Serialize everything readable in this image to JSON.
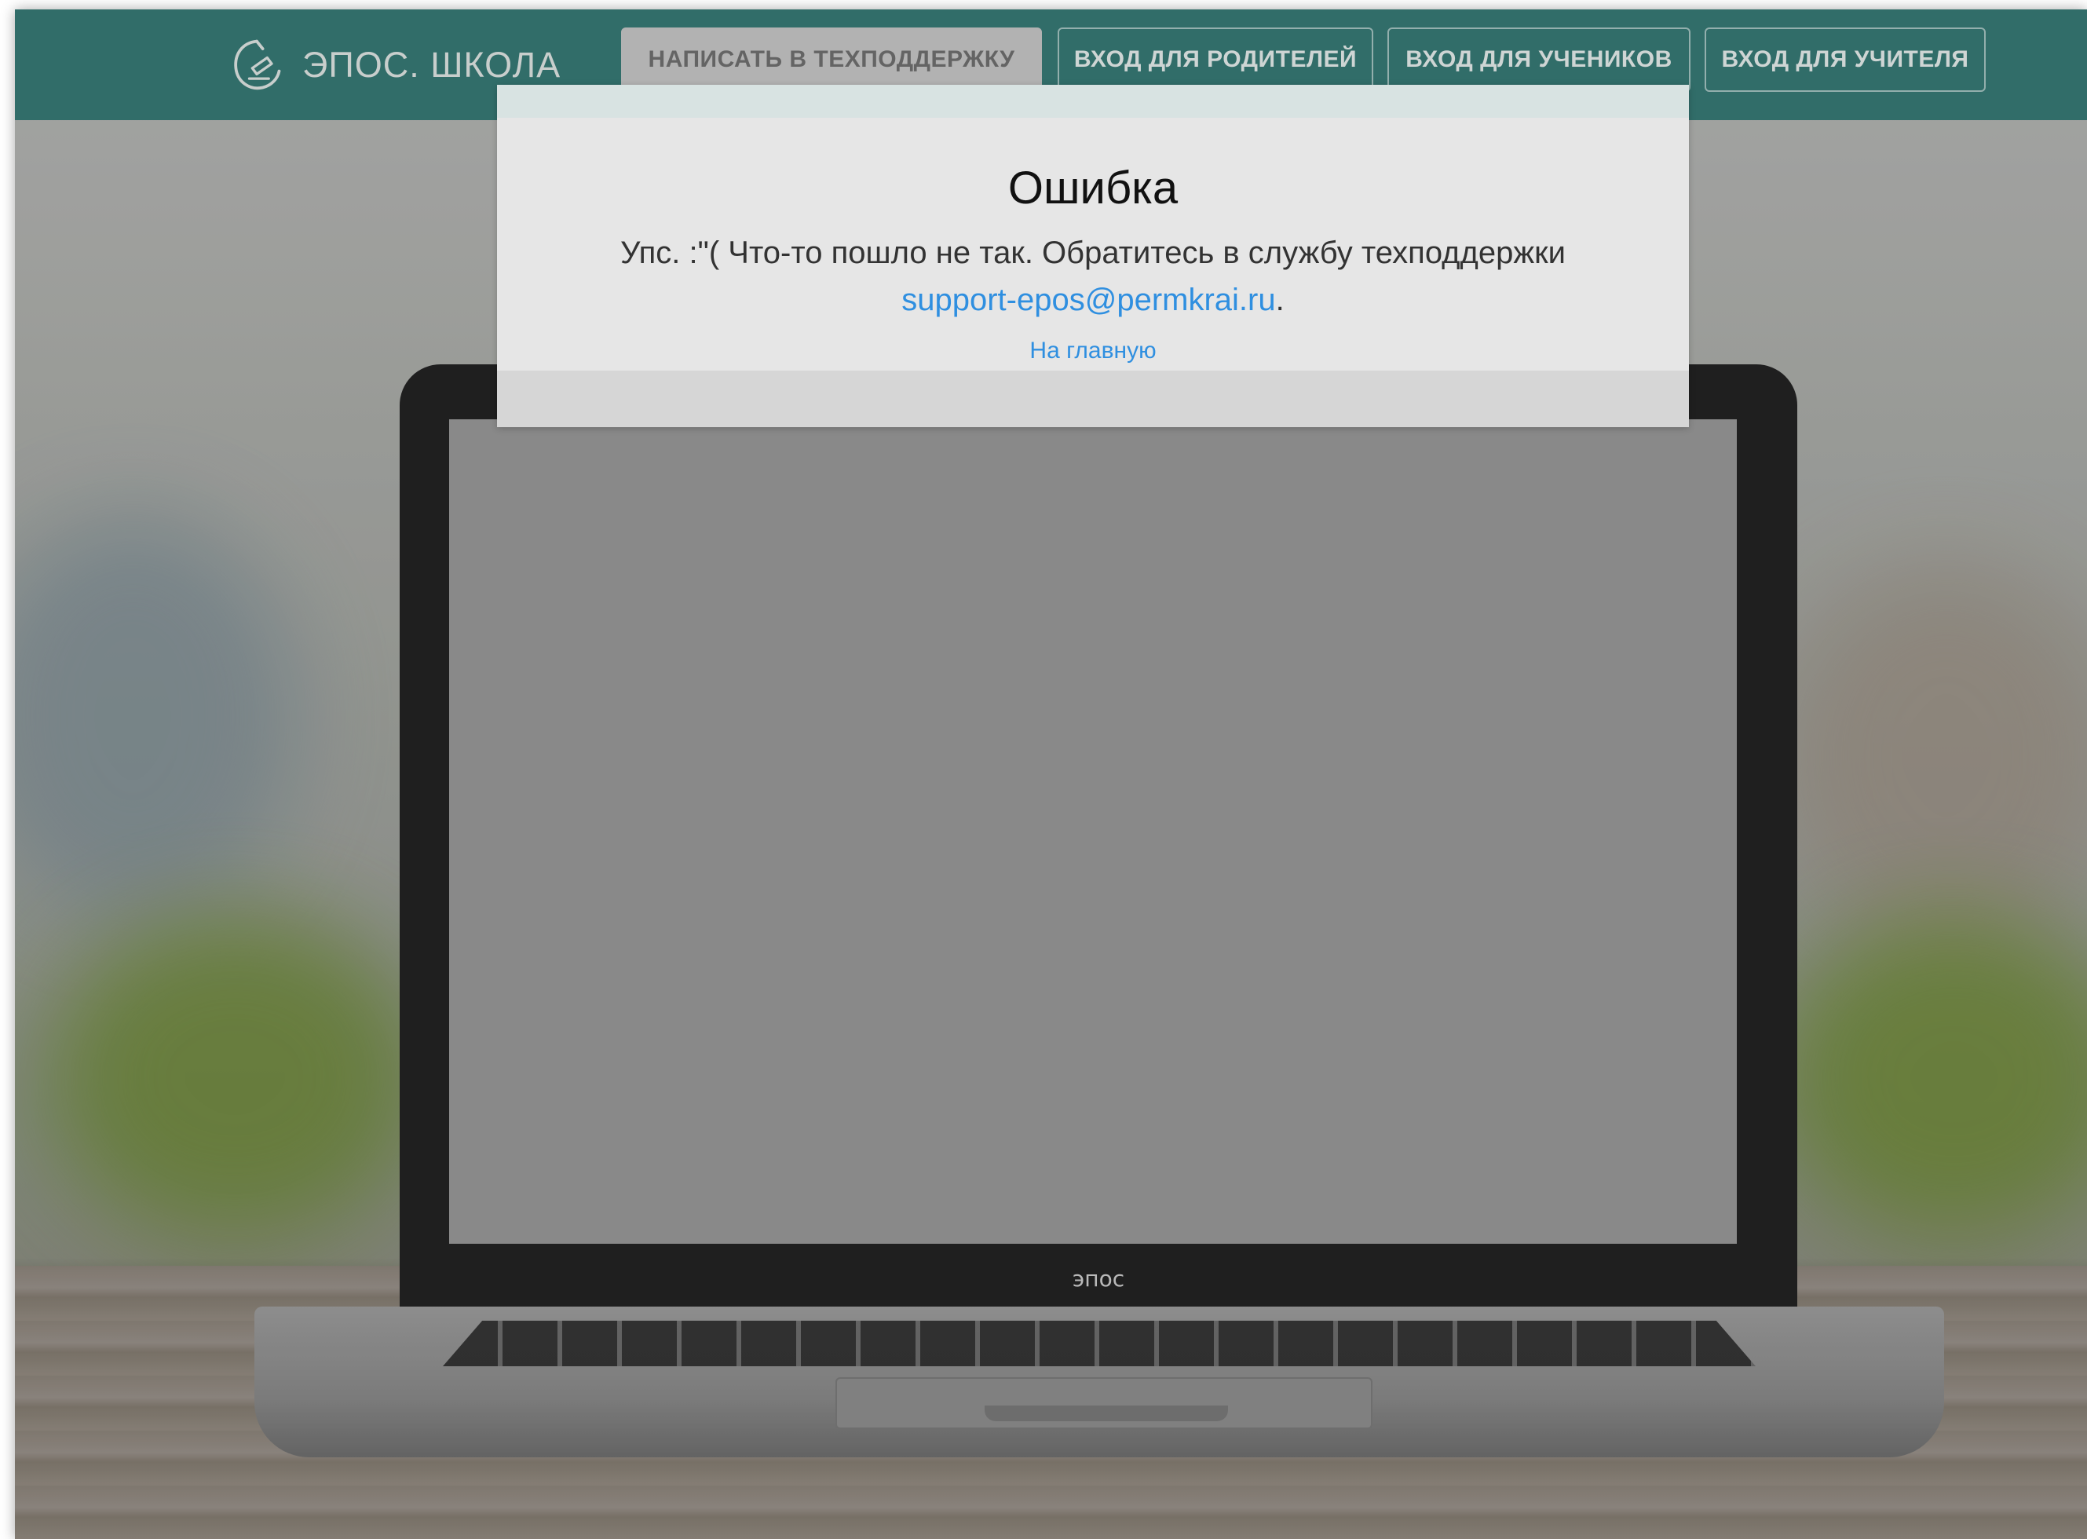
{
  "header": {
    "logo_text": "ЭПОС. ШКОЛА",
    "buttons": {
      "support": "НАПИСАТЬ В ТЕХПОДДЕРЖКУ",
      "parents": "ВХОД ДЛЯ РОДИТЕЛЕЙ",
      "students": "ВХОД ДЛЯ УЧЕНИКОВ",
      "teacher": "ВХОД ДЛЯ УЧИТЕЛЯ"
    },
    "color": "#377a75"
  },
  "modal": {
    "title": "Ошибка",
    "message": "Упс. :\"( Что-то пошло не так. Обратитесь в службу техподдержки",
    "email": "support-epos@permkrai.ru",
    "email_suffix": ".",
    "home_link": "На главную",
    "link_color": "#2f8fe0"
  },
  "laptop": {
    "brand": "эпос"
  }
}
